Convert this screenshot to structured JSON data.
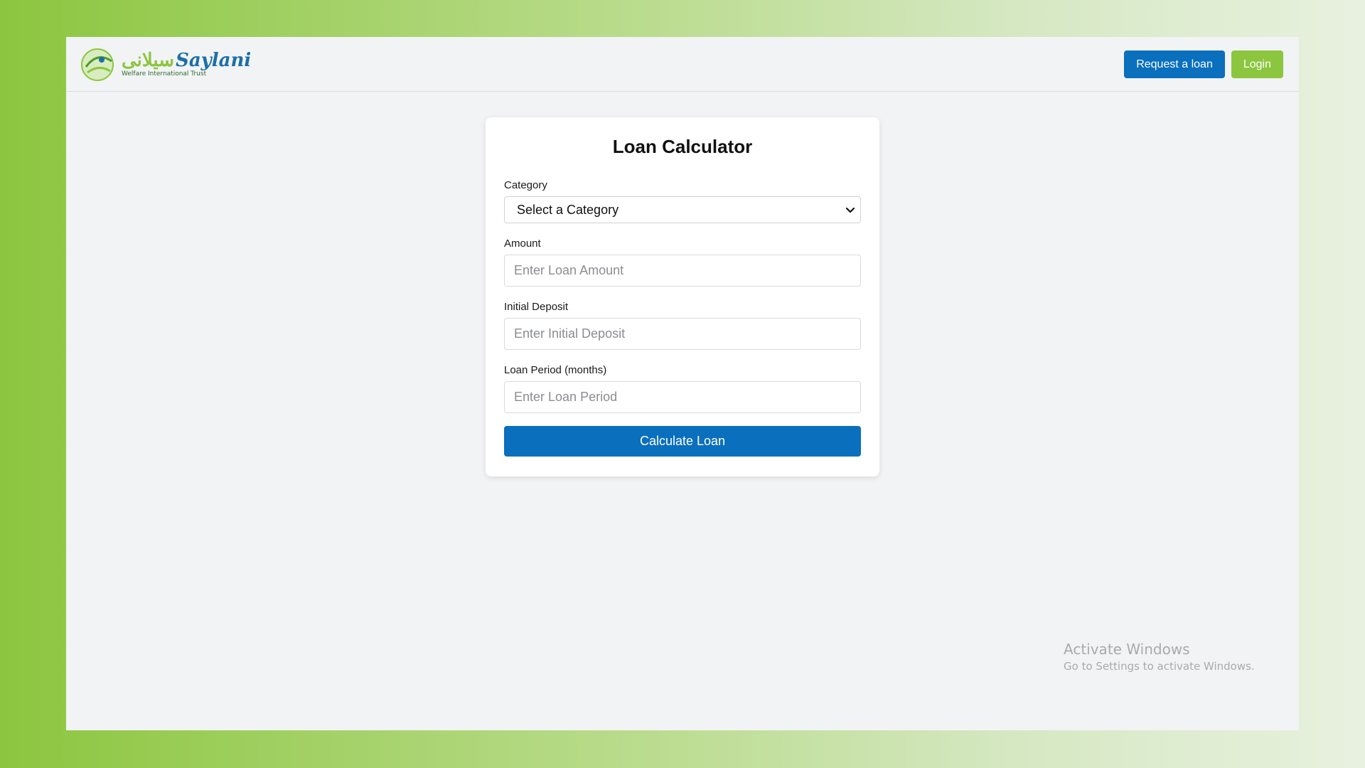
{
  "brand": {
    "latin": "Saylani",
    "urdu": "سیلانی",
    "tagline": "Welfare International Trust"
  },
  "nav": {
    "request_label": "Request a loan",
    "login_label": "Login"
  },
  "form": {
    "title": "Loan Calculator",
    "category": {
      "label": "Category",
      "selected": "Select a Category"
    },
    "amount": {
      "label": "Amount",
      "placeholder": "Enter Loan Amount"
    },
    "deposit": {
      "label": "Initial Deposit",
      "placeholder": "Enter Initial Deposit"
    },
    "period": {
      "label": "Loan Period (months)",
      "placeholder": "Enter Loan Period"
    },
    "submit_label": "Calculate Loan"
  },
  "watermark": {
    "title": "Activate Windows",
    "subtitle": "Go to Settings to activate Windows."
  },
  "colors": {
    "primary": "#0a6fbd",
    "accent_green": "#8cc63f",
    "page_bg": "#f2f3f5"
  },
  "icons": {
    "logo": "saylani-logo-icon",
    "select_arrow": "chevron-down-icon"
  }
}
